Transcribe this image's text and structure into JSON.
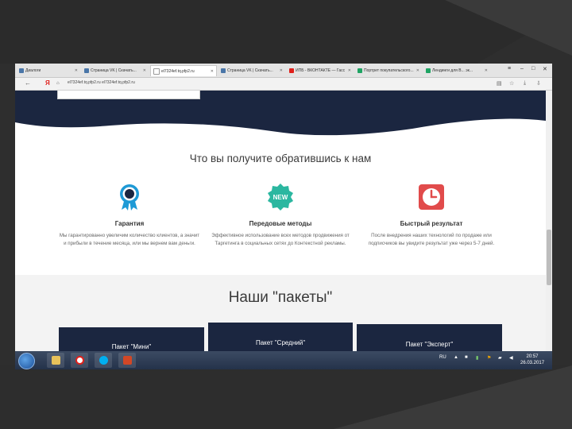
{
  "browser": {
    "tabs": [
      {
        "label": "Диалоги",
        "icon": "vk-icon",
        "color": "#4a76a8"
      },
      {
        "label": "Страница VK | Скачать...",
        "icon": "vk-icon",
        "color": "#4a76a8"
      },
      {
        "label": "el7324ef.tq.pfp2.ru",
        "icon": "page-icon",
        "color": "#999999"
      },
      {
        "label": "Страница VK | Скачать...",
        "icon": "vk-icon",
        "color": "#4a76a8"
      },
      {
        "label": "ИПБ - ВКОНТАКТЕ — Гасс",
        "icon": "yandex-icon",
        "color": "#e0201b"
      },
      {
        "label": "Портрет покупательского...",
        "icon": "sheet-icon",
        "color": "#1fa463"
      },
      {
        "label": "Лендинги для В... эк...",
        "icon": "sheet-icon",
        "color": "#1fa463"
      }
    ],
    "url": "el7324ef.tq.pfp2.ru   el7324ef.tq.pfp2.ru"
  },
  "page": {
    "section_title": "Что вы получите обратившись к нам",
    "features": [
      {
        "title": "Гарантия",
        "desc": "Мы гарантированно увеличим количество клиентов, а значит и прибыли в течение месяца, или мы вернем вам деньги.",
        "icon": "ribbon-award-icon"
      },
      {
        "title": "Передовые методы",
        "desc": "Эффективное использование всех методов продвижения от Таргетинга в социальных сетях до Контекстной рекламы.",
        "icon": "new-badge-icon",
        "badge": "NEW"
      },
      {
        "title": "Быстрый результат",
        "desc": "После внедрения наших технологий по продаже или подписчиков вы увидите результат уже через 5-7 дней.",
        "icon": "clock-icon"
      }
    ],
    "packs_title": "Наши \"пакеты\"",
    "packs": [
      "Пакет \"Мини\"",
      "Пакет \"Средний\"",
      "Пакет \"Эксперт\""
    ]
  },
  "taskbar": {
    "lang": "RU",
    "time": "20:57",
    "date": "26.03.2017"
  },
  "colors": {
    "hero_dark": "#1b2640",
    "accent_blue": "#1e9ad6",
    "accent_teal": "#2bb7a0",
    "accent_red": "#e14b4b"
  }
}
